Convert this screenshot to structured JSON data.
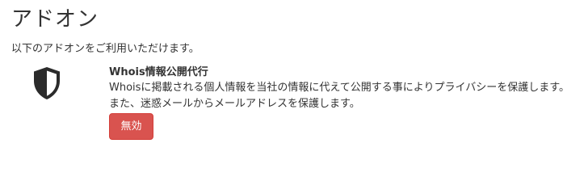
{
  "page": {
    "title": "アドオン",
    "intro": "以下のアドオンをご利用いただけます。"
  },
  "addons": [
    {
      "icon": "shield-icon",
      "name": "Whois情報公開代行",
      "description": "Whoisに掲載される個人情報を当社の情報に代えて公開する事によりプライバシーを保護します。また、迷惑メールからメールアドレスを保護します。",
      "button_label": "無効",
      "button_color": "#d9534f"
    }
  ]
}
